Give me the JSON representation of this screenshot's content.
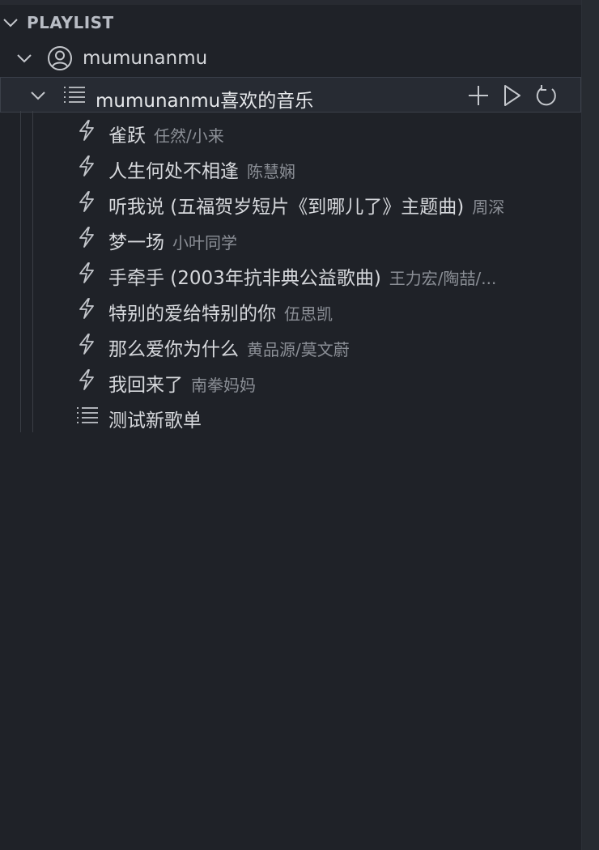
{
  "section": {
    "title": "PLAYLIST",
    "expanded": true
  },
  "user": {
    "name": "mumunanmu",
    "icon": "account-icon",
    "expanded": true
  },
  "liked_playlist": {
    "name": "mumunanmu喜欢的音乐",
    "icon": "list-icon",
    "expanded": true,
    "actions": [
      {
        "name": "add-icon"
      },
      {
        "name": "play-icon"
      },
      {
        "name": "refresh-icon"
      }
    ],
    "songs": [
      {
        "title": "雀跃",
        "artist": "任然/小来"
      },
      {
        "title": "人生何处不相逢",
        "artist": "陈慧娴"
      },
      {
        "title": "听我说 (五福贺岁短片《到哪儿了》主题曲)",
        "artist": "周深"
      },
      {
        "title": "梦一场",
        "artist": "小叶同学"
      },
      {
        "title": "手牵手 (2003年抗非典公益歌曲)",
        "artist": "王力宏/陶喆/..."
      },
      {
        "title": "特别的爱给特别的你",
        "artist": "伍思凯"
      },
      {
        "title": "那么爱你为什么",
        "artist": "黄品源/莫文蔚"
      },
      {
        "title": "我回来了",
        "artist": "南拳妈妈"
      }
    ]
  },
  "other_playlists": [
    {
      "name": "测试新歌单",
      "icon": "list-icon"
    }
  ],
  "colors": {
    "background": "#1f2228",
    "text": "#d6d8dc",
    "muted": "#8b8f96",
    "selected_row": "#272b33"
  }
}
